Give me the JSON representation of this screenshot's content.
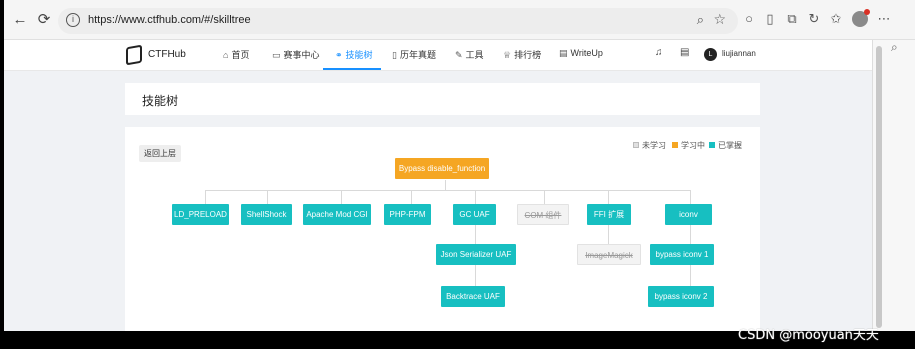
{
  "browser": {
    "back": "←",
    "reload": "⟳",
    "url": "https://www.ctfhub.com/#/skilltree"
  },
  "site": {
    "brand": "CTFHub",
    "nav": [
      {
        "icon": "⌂",
        "label": "首页"
      },
      {
        "icon": "▭",
        "label": "赛事中心"
      },
      {
        "icon": "⚭",
        "label": "技能树"
      },
      {
        "icon": "▯",
        "label": "历年真题"
      },
      {
        "icon": "✎",
        "label": "工具"
      },
      {
        "icon": "♕",
        "label": "排行榜"
      },
      {
        "icon": "▤",
        "label": "WriteUp"
      }
    ],
    "active_tab": "技能树",
    "user_initial": "L",
    "username": "liujiannan"
  },
  "page_title": "技能树",
  "back_button": "返回上层",
  "legend": [
    {
      "label": "未学习",
      "color": "#e0e0e0"
    },
    {
      "label": "学习中",
      "color": "#f5a623"
    },
    {
      "label": "已掌握",
      "color": "#17bfc1"
    }
  ],
  "tree": {
    "root": {
      "label": "Bypass disable_function",
      "status": "learning"
    },
    "children": [
      {
        "label": "LD_PRELOAD",
        "status": "mastered"
      },
      {
        "label": "ShellShock",
        "status": "mastered"
      },
      {
        "label": "Apache Mod CGI",
        "status": "mastered"
      },
      {
        "label": "PHP-FPM",
        "status": "mastered"
      },
      {
        "label": "GC UAF",
        "status": "mastered"
      },
      {
        "label": "COM 组件",
        "status": "unlearned"
      },
      {
        "label": "FFI 扩展",
        "status": "mastered"
      },
      {
        "label": "iconv",
        "status": "mastered"
      }
    ],
    "grandchildren": [
      {
        "label": "Json Serializer UAF",
        "status": "mastered"
      },
      {
        "label": "Backtrace UAF",
        "status": "mastered"
      },
      {
        "label": "ImageMagick",
        "status": "unlearned"
      },
      {
        "label": "bypass iconv 1",
        "status": "mastered"
      },
      {
        "label": "bypass iconv 2",
        "status": "mastered"
      }
    ]
  },
  "watermark": "CSDN @mooyuan天天"
}
